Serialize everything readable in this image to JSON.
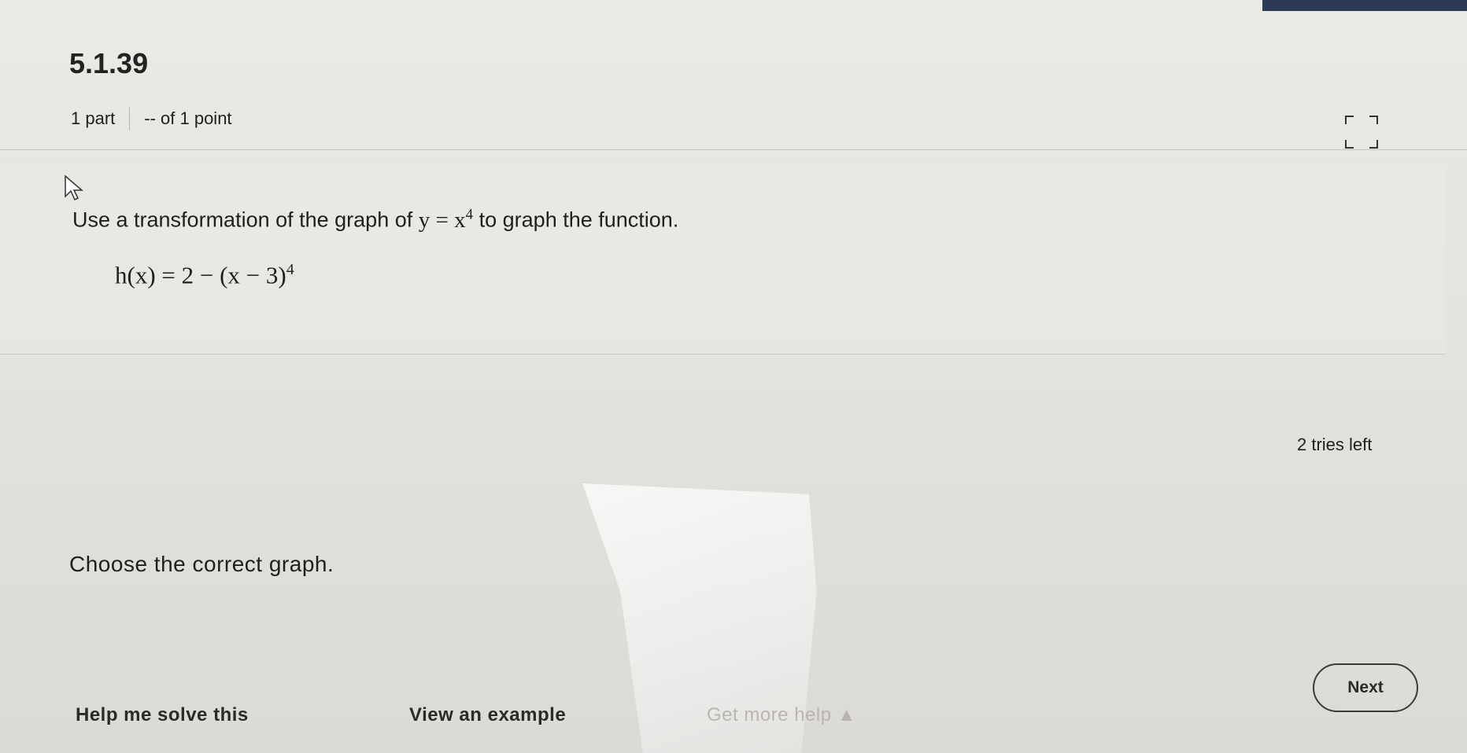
{
  "header": {
    "problem_number": "5.1.39",
    "parts": "1 part",
    "points": "-- of 1 point"
  },
  "question": {
    "prefix": "Use a transformation of the graph of",
    "base_function": "y = x",
    "base_exponent": "4",
    "suffix": "to graph the function.",
    "function_lhs": "h(x) = 2 − (x − 3)",
    "function_exponent": "4"
  },
  "status": {
    "tries_left": "2 tries left"
  },
  "instruction": "Choose the correct graph.",
  "footer": {
    "help_solve": "Help me solve this",
    "view_example": "View an example",
    "more_help": "Get more help ▲",
    "next_label": "Next"
  },
  "icons": {
    "expand": "expand-icon",
    "cursor": "mouse-pointer-icon"
  },
  "colors": {
    "background": "#e6e4df",
    "text": "#1f1f1f",
    "muted": "#b9b6b0"
  }
}
